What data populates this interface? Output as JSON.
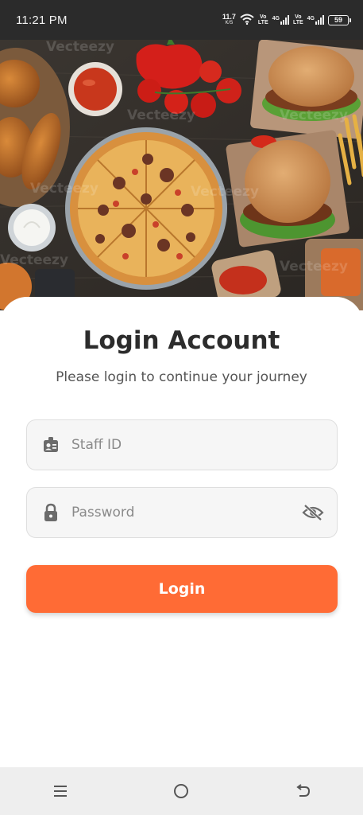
{
  "status_bar": {
    "time": "11:21 PM",
    "net_speed_value": "11.7",
    "net_speed_unit": "K/S",
    "sim1_label_top": "Vo",
    "sim1_label_bottom": "LTE",
    "sim1_network": "4G",
    "sim2_label_top": "Vo",
    "sim2_label_bottom": "LTE",
    "sim2_network": "4G",
    "battery_level": "59",
    "icons": [
      "wifi-icon",
      "signal-icon",
      "signal-icon",
      "battery-icon"
    ]
  },
  "hero": {
    "watermark": "Vecteezy",
    "description_icons": [
      "pizza",
      "burger",
      "fried-chicken",
      "tomatoes",
      "sauce",
      "fries"
    ]
  },
  "login": {
    "title": "Login Account",
    "subtitle": "Please login to continue your journey",
    "staff_id_placeholder": "Staff ID",
    "staff_id_value": "",
    "password_placeholder": "Password",
    "password_value": "",
    "staff_icon": "id-badge-icon",
    "password_icon": "lock-icon",
    "visibility_icon": "eye-off-icon",
    "button_label": "Login"
  },
  "nav_bar": {
    "icons": [
      "menu-icon",
      "home-icon",
      "back-icon"
    ]
  },
  "colors": {
    "accent": "#ff6b35",
    "status_bar_bg": "#2b2b2b",
    "title_text": "#2c2c2c",
    "field_bg": "#f6f6f6",
    "nav_bar_bg": "#eeeeee"
  }
}
